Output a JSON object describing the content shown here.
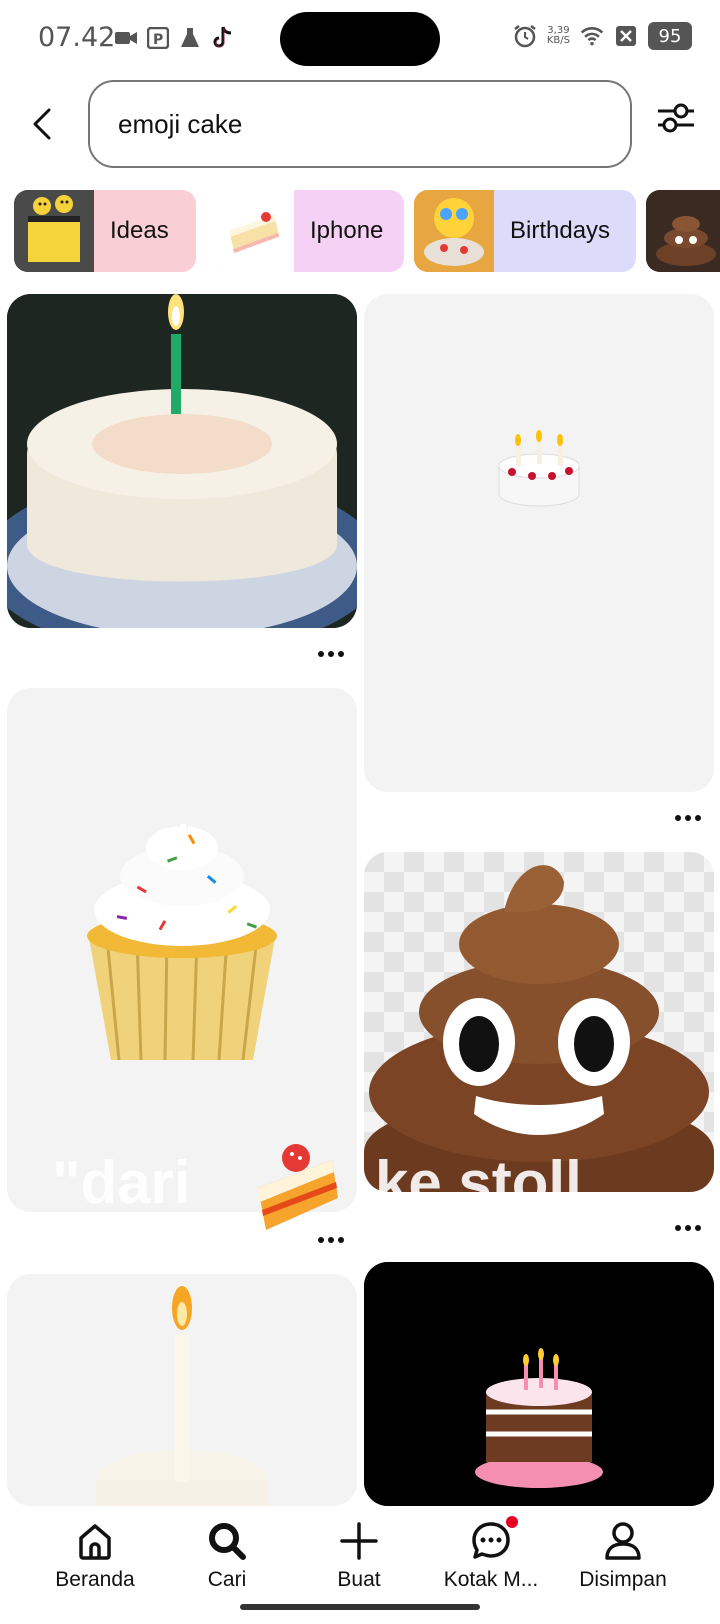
{
  "status_bar": {
    "time": "07.42",
    "net_speed_top": "3,39",
    "net_speed_unit": "KB/S",
    "battery": "95"
  },
  "search": {
    "query": "emoji cake"
  },
  "chips": [
    {
      "label": "Ideas",
      "color": "#f9cfd5"
    },
    {
      "label": "Iphone",
      "color": "#f5d2f5"
    },
    {
      "label": "Birthdays",
      "color": "#dcdcfa"
    }
  ],
  "overlay": {
    "text_left": "\"dari",
    "text_right": "ke stoll"
  },
  "nav": {
    "home": "Beranda",
    "search": "Cari",
    "create": "Buat",
    "inbox": "Kotak M...",
    "saved": "Disimpan"
  }
}
